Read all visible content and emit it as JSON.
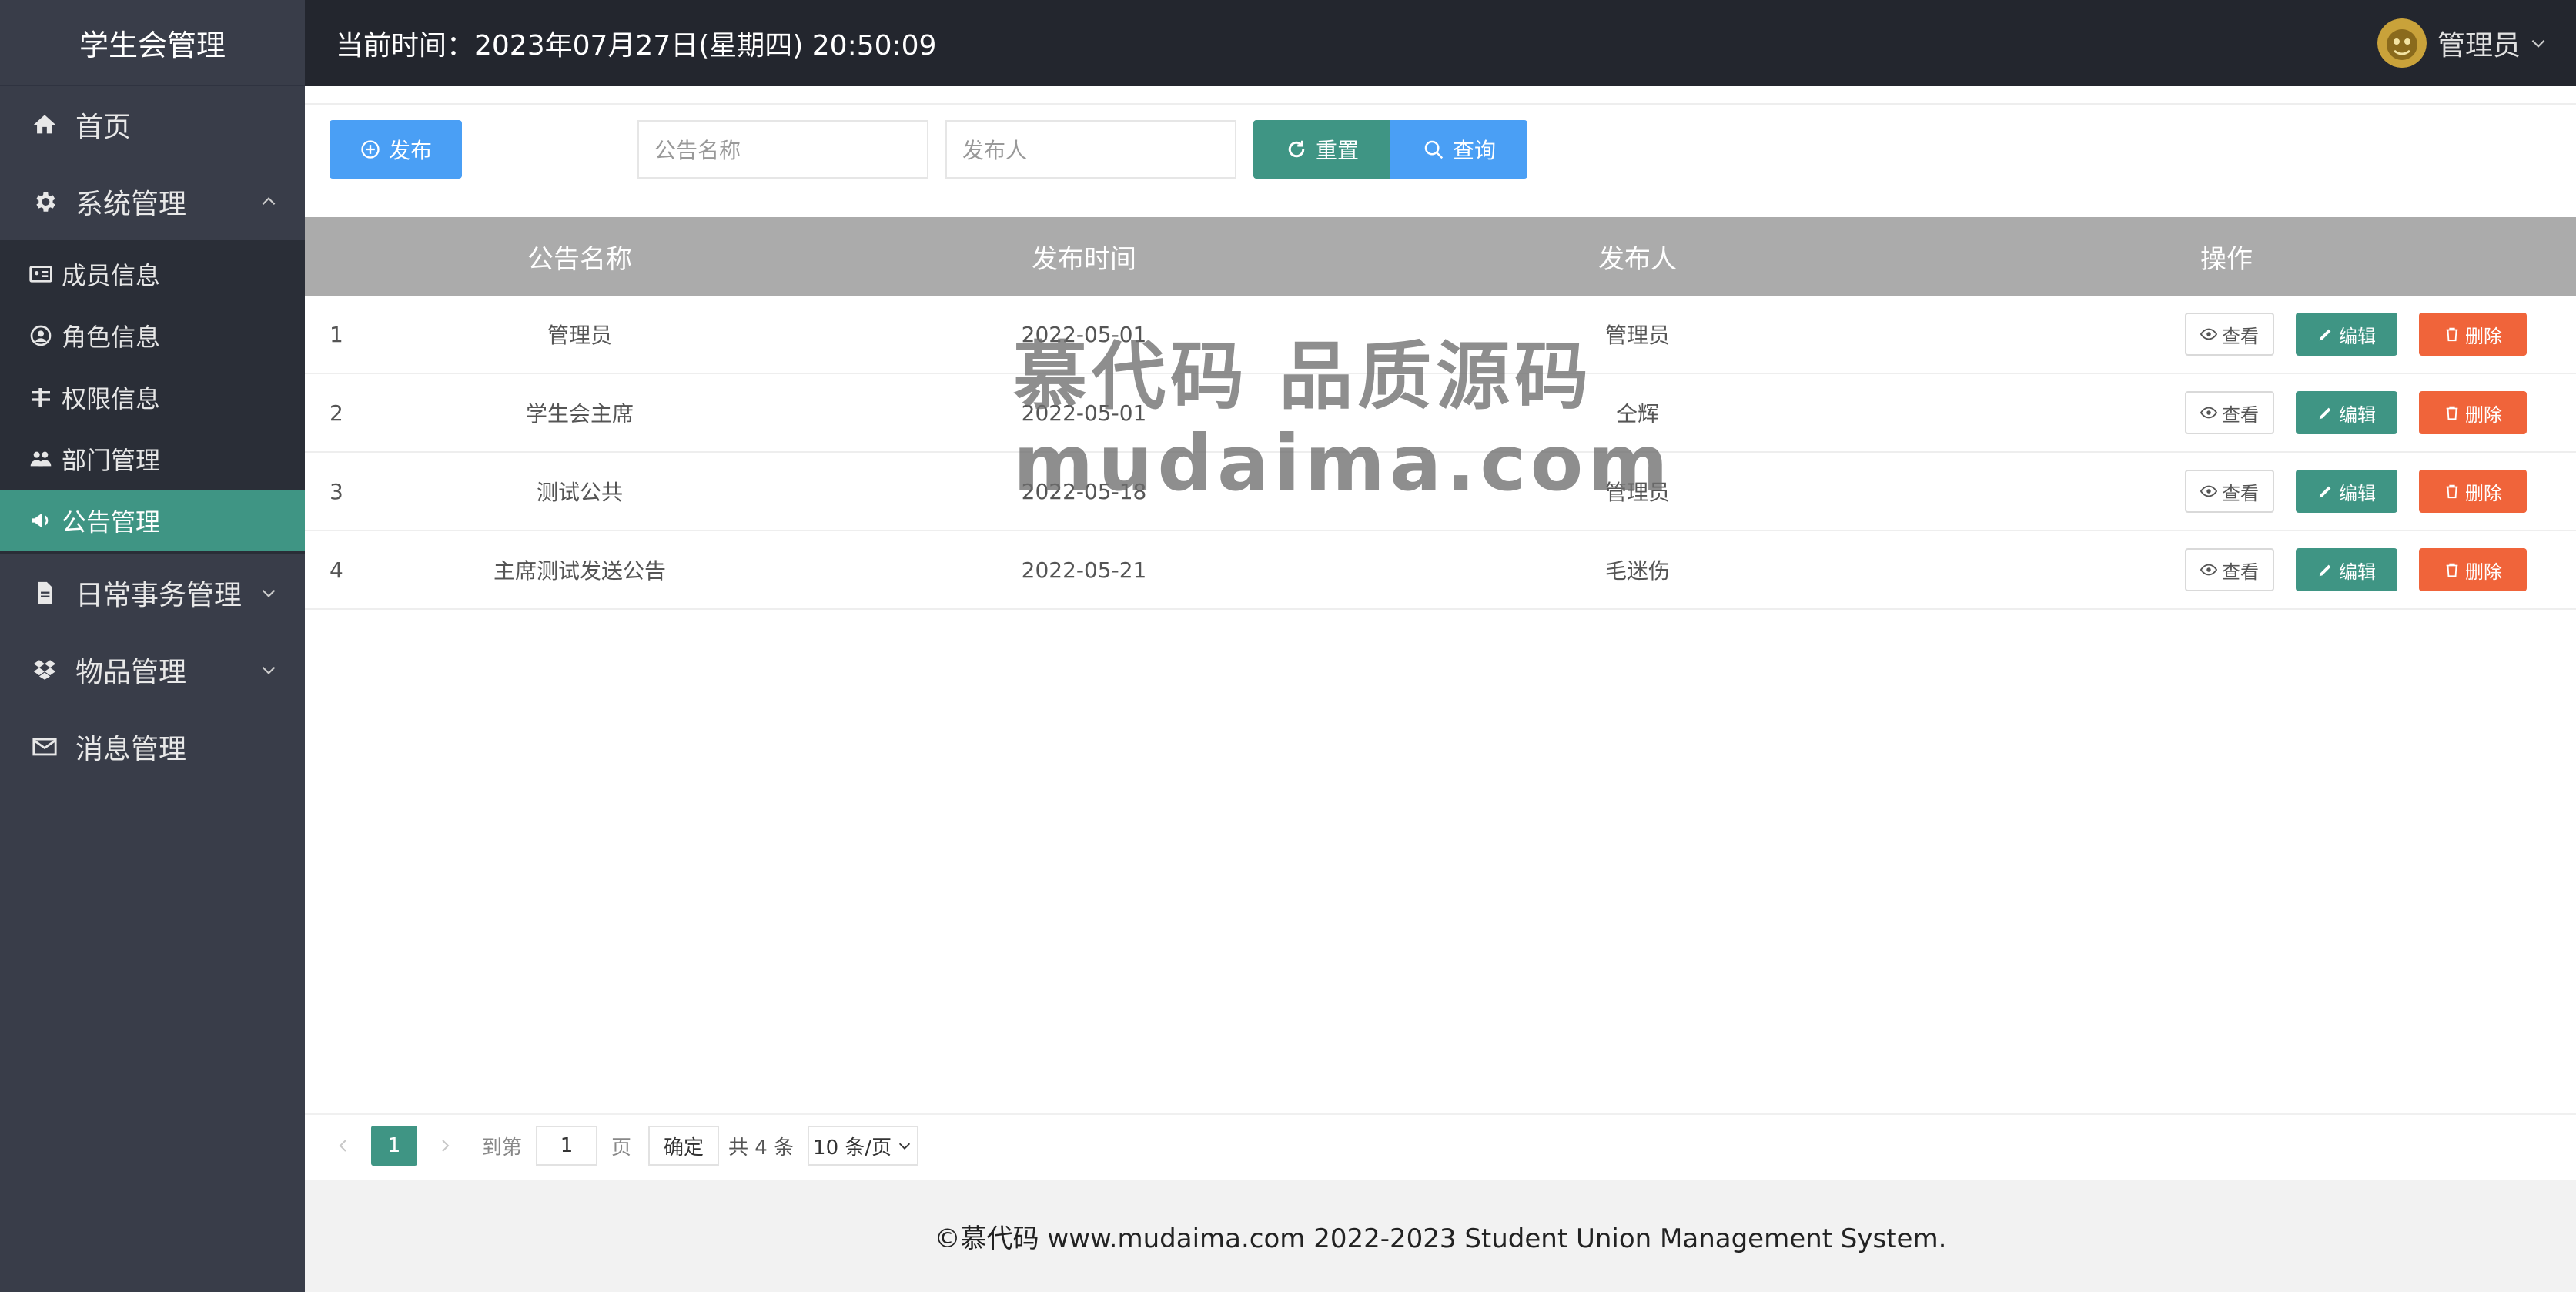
{
  "sidebar": {
    "brand": "学生会管理",
    "home": "首页",
    "system": "系统管理",
    "sub_items": [
      "成员信息",
      "角色信息",
      "权限信息",
      "部门管理",
      "公告管理"
    ],
    "daily": "日常事务管理",
    "goods": "物品管理",
    "messages": "消息管理"
  },
  "header": {
    "clock": "当前时间：2023年07月27日(星期四) 20:50:09",
    "user": "管理员"
  },
  "toolbar": {
    "publish": "发布",
    "name_placeholder": "公告名称",
    "publisher_placeholder": "发布人",
    "reset": "重置",
    "query": "查询"
  },
  "table": {
    "headers": [
      "公告名称",
      "发布时间",
      "发布人",
      "操作"
    ],
    "rows": [
      {
        "idx": "1",
        "name": "管理员",
        "time": "2022-05-01",
        "publisher": "管理员"
      },
      {
        "idx": "2",
        "name": "学生会主席",
        "time": "2022-05-01",
        "publisher": "仝辉"
      },
      {
        "idx": "3",
        "name": "测试公共",
        "time": "2022-05-18",
        "publisher": "管理员"
      },
      {
        "idx": "4",
        "name": "主席测试发送公告",
        "time": "2022-05-21",
        "publisher": "毛迷伤"
      }
    ],
    "actions": {
      "view": "查看",
      "edit": "编辑",
      "delete": "删除"
    }
  },
  "watermark": {
    "line1": "慕代码 品质源码",
    "line2": "mudaima.com"
  },
  "pager": {
    "current": "1",
    "goto": "到第",
    "page_input": "1",
    "page_unit": "页",
    "confirm": "确定",
    "total": "共 4 条",
    "per_page": "10 条/页"
  },
  "footer": "©慕代码 www.mudaima.com 2022-2023 Student Union Management System.",
  "colors": {
    "accent": "#3f9584",
    "primary": "#4a9ff5",
    "danger": "#f0643a",
    "sidebar": "#393d49",
    "header": "#23262e"
  }
}
